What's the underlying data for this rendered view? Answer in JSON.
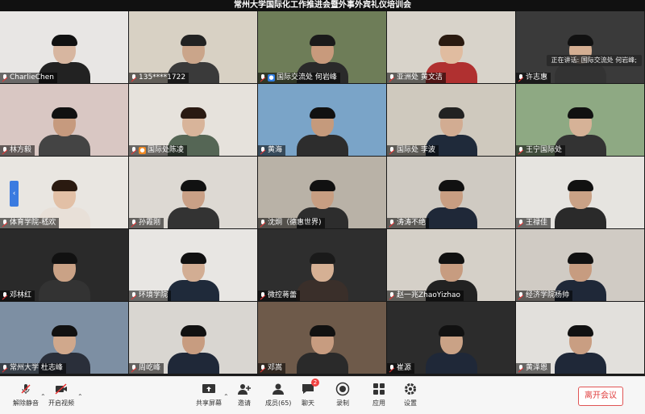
{
  "meeting": {
    "title": "常州大学国际化工作推进会暨外事外宾礼仪培训会",
    "speaking_prefix": "正在讲话:",
    "speaking_name": "国际交流处 何岩峰;"
  },
  "participants": [
    {
      "name": "CharlieChen",
      "tag": "",
      "bg": "#e8e6e4",
      "skin": "#d7b6a0",
      "shirt": "#222",
      "hair": "#111"
    },
    {
      "name": "135****1722",
      "tag": "",
      "bg": "#d8d1c4",
      "skin": "#caa58a",
      "shirt": "#3a3a3a",
      "hair": "#222"
    },
    {
      "name": "国际交流处 何岩峰",
      "tag": "blue",
      "bg": "#6e7d58",
      "skin": "#c89a7c",
      "shirt": "#2a2a2a",
      "hair": "#1a1a1a",
      "active": true
    },
    {
      "name": "亚洲处  黄文洁",
      "tag": "",
      "bg": "#d8d3ca",
      "skin": "#e0bca0",
      "shirt": "#b03030",
      "hair": "#2a1a10"
    },
    {
      "name": "许志惠",
      "tag": "",
      "bg": "#3a3a3a",
      "skin": "#d4ae92",
      "shirt": "#333",
      "hair": "#111"
    },
    {
      "name": "林方毅",
      "tag": "",
      "bg": "#d9c7c3",
      "skin": "#c69a7e",
      "shirt": "#444",
      "hair": "#111"
    },
    {
      "name": "国际处陈凌",
      "tag": "orange",
      "bg": "#e6e2dc",
      "skin": "#d8b49a",
      "shirt": "#556655",
      "hair": "#2a1a12"
    },
    {
      "name": "黄海",
      "tag": "",
      "bg": "#7aa4c8",
      "skin": "#c59a7c",
      "shirt": "#2d2d2d",
      "hair": "#111"
    },
    {
      "name": "国际处 李波",
      "tag": "",
      "bg": "#cfc9be",
      "skin": "#d2ac92",
      "shirt": "#1f2a3a",
      "hair": "#222"
    },
    {
      "name": "王宁国际处",
      "tag": "",
      "bg": "#8ea983",
      "skin": "#d6b297",
      "shirt": "#333",
      "hair": "#111"
    },
    {
      "name": "体育学院-嵇欢",
      "tag": "",
      "bg": "#e9e6e1",
      "skin": "#e2c0a6",
      "shirt": "#e8e0d8",
      "hair": "#2a1a10"
    },
    {
      "name": "孙霞刚",
      "tag": "",
      "bg": "#ddd9d3",
      "skin": "#c9a086",
      "shirt": "#333",
      "hair": "#111"
    },
    {
      "name": "沈炯（德惠世界)",
      "tag": "",
      "bg": "#b9b2a7",
      "skin": "#c79e82",
      "shirt": "#2d2d2d",
      "hair": "#111"
    },
    {
      "name": "涛涛不绝",
      "tag": "",
      "bg": "#cfcac2",
      "skin": "#c89e82",
      "shirt": "#1f2838",
      "hair": "#111"
    },
    {
      "name": "王禄佳",
      "tag": "",
      "bg": "#e6e4e0",
      "skin": "#caa286",
      "shirt": "#2a2a2a",
      "hair": "#111"
    },
    {
      "name": "邓林红",
      "tag": "",
      "bg": "#2a2a2a",
      "skin": "#caa286",
      "shirt": "#333",
      "hair": "#111"
    },
    {
      "name": "环境学院",
      "tag": "",
      "bg": "#e8e6e3",
      "skin": "#d2ad93",
      "shirt": "#1f2a3a",
      "hair": "#111"
    },
    {
      "name": "微控蒋蕾",
      "tag": "",
      "bg": "#2e2e2e",
      "skin": "#d5b094",
      "shirt": "#3a2f2a",
      "hair": "#1a1a1a"
    },
    {
      "name": "赵一兆ZhaoYizhao",
      "tag": "",
      "bg": "#d5d0c8",
      "skin": "#c79c80",
      "shirt": "#222",
      "hair": "#111"
    },
    {
      "name": "经济学院杨帅",
      "tag": "",
      "bg": "#d0cbc4",
      "skin": "#c79c80",
      "shirt": "#1f2838",
      "hair": "#111"
    },
    {
      "name": "常州大学 杜志峰",
      "tag": "",
      "bg": "#7d8fa3",
      "skin": "#d0a88c",
      "shirt": "#2a2f3a",
      "hair": "#111"
    },
    {
      "name": "周屹峰",
      "tag": "",
      "bg": "#d9d6d1",
      "skin": "#c79c80",
      "shirt": "#1f2838",
      "hair": "#111"
    },
    {
      "name": "邓嵩",
      "tag": "",
      "bg": "#6e5a4a",
      "skin": "#c79c80",
      "shirt": "#2a2a2a",
      "hair": "#111"
    },
    {
      "name": "崔源",
      "tag": "",
      "bg": "#2c2c2c",
      "skin": "#caa286",
      "shirt": "#1f2838",
      "hair": "#111"
    },
    {
      "name": "黄泽恩",
      "tag": "",
      "bg": "#e2e0dc",
      "skin": "#c99e82",
      "shirt": "#1f2838",
      "hair": "#111"
    }
  ],
  "toolbar": {
    "unmute": "解除静音",
    "start_video": "开启视频",
    "share_screen": "共享屏幕",
    "invite": "邀请",
    "members": "成员(65)",
    "chat": "聊天",
    "chat_badge": "2",
    "record": "录制",
    "apps": "应用",
    "settings": "设置",
    "leave": "离开会议"
  }
}
